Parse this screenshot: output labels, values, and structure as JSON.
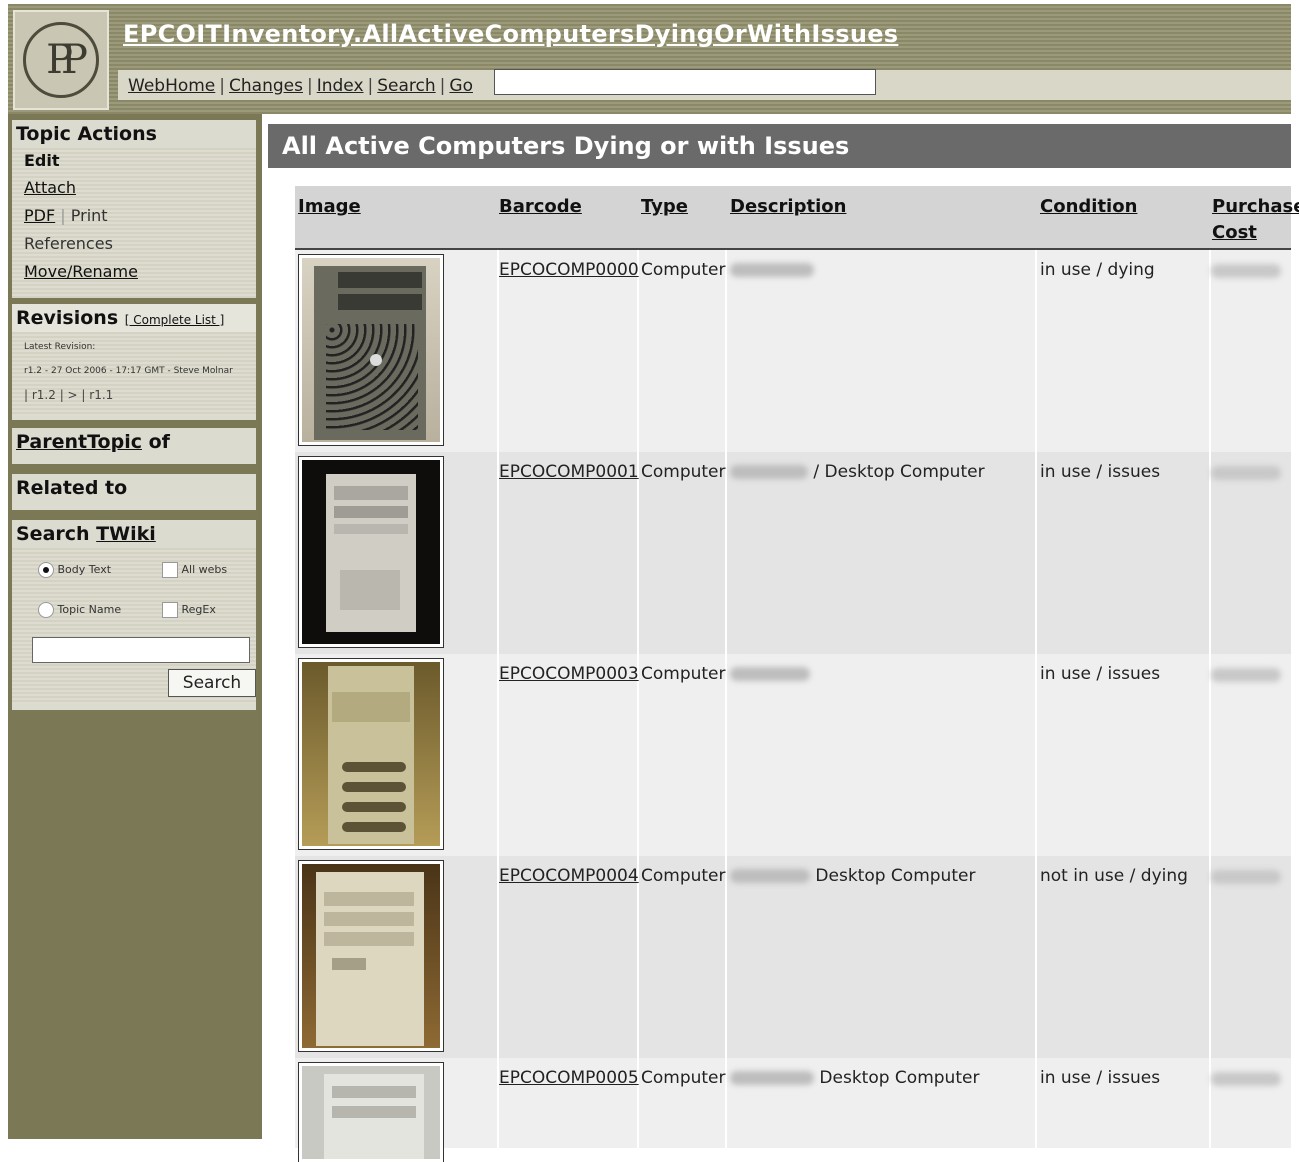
{
  "header": {
    "logo_text": "P",
    "topic_title": "EPCOITInventory.AllActiveComputersDyingOrWithIssues",
    "nav": [
      "WebHome",
      "Changes",
      "Index",
      "Search",
      "Go"
    ]
  },
  "sidebar": {
    "topic_actions": {
      "title": "Topic Actions",
      "items": [
        "Edit",
        "Attach",
        "PDF",
        "Print",
        "References",
        "Move/Rename"
      ]
    },
    "revisions": {
      "title": "Revisions",
      "complete_list": "[ Complete List ]",
      "latest_label": "Latest Revision:",
      "latest_value": "r1.2 - 27 Oct 2006 - 17:17 GMT - Steve Molnar",
      "links": "| r1.2 | > | r1.1"
    },
    "parent": {
      "link": "ParentTopic",
      "suffix": " of"
    },
    "related": {
      "title": "Related to"
    },
    "search": {
      "title_prefix": "Search ",
      "title_link": "TWiki",
      "opt_body": "Body Text",
      "opt_all_webs": "All webs",
      "opt_topic": "Topic Name",
      "opt_regex": "RegEx",
      "button": "Search"
    }
  },
  "main": {
    "heading": "All Active Computers Dying or with Issues",
    "columns": [
      "Image",
      "Barcode",
      "Type",
      "Description",
      "Condition",
      "Purchase",
      "Cost"
    ],
    "rows": [
      {
        "barcode": "EPCOCOMP0000",
        "type": "Computer",
        "desc": "",
        "condition": "in use / dying"
      },
      {
        "barcode": "EPCOCOMP0001",
        "type": "Computer",
        "desc": "/ Desktop Computer",
        "condition": "in use / issues"
      },
      {
        "barcode": "EPCOCOMP0003",
        "type": "Computer",
        "desc": "",
        "condition": "in use / issues"
      },
      {
        "barcode": "EPCOCOMP0004",
        "type": "Computer",
        "desc": "Desktop Computer",
        "condition": "not in use / dying"
      },
      {
        "barcode": "EPCOCOMP0005",
        "type": "Computer",
        "desc": "Desktop Computer",
        "condition": "in use / issues"
      }
    ]
  }
}
